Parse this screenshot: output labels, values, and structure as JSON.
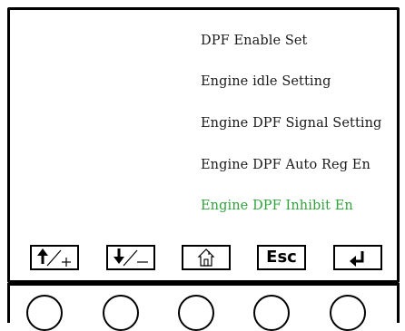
{
  "menu": {
    "items": [
      {
        "label": "DPF Enable Set",
        "selected": false
      },
      {
        "label": "Engine idle Setting",
        "selected": false
      },
      {
        "label": "Engine DPF Signal Setting",
        "selected": false
      },
      {
        "label": "Engine DPF Auto Reg En",
        "selected": false
      },
      {
        "label": "Engine DPF Inhibit En",
        "selected": true
      }
    ]
  },
  "softkeys": {
    "up_plus": {
      "icon": "arrow-up-plus-icon"
    },
    "down_minus": {
      "icon": "arrow-down-minus-icon"
    },
    "home": {
      "icon": "home-icon"
    },
    "esc": {
      "label": "Esc"
    },
    "enter": {
      "icon": "enter-return-icon"
    }
  },
  "colors": {
    "selected_text": "#2fa33a",
    "text": "#1a1a1a",
    "frame": "#000000"
  }
}
